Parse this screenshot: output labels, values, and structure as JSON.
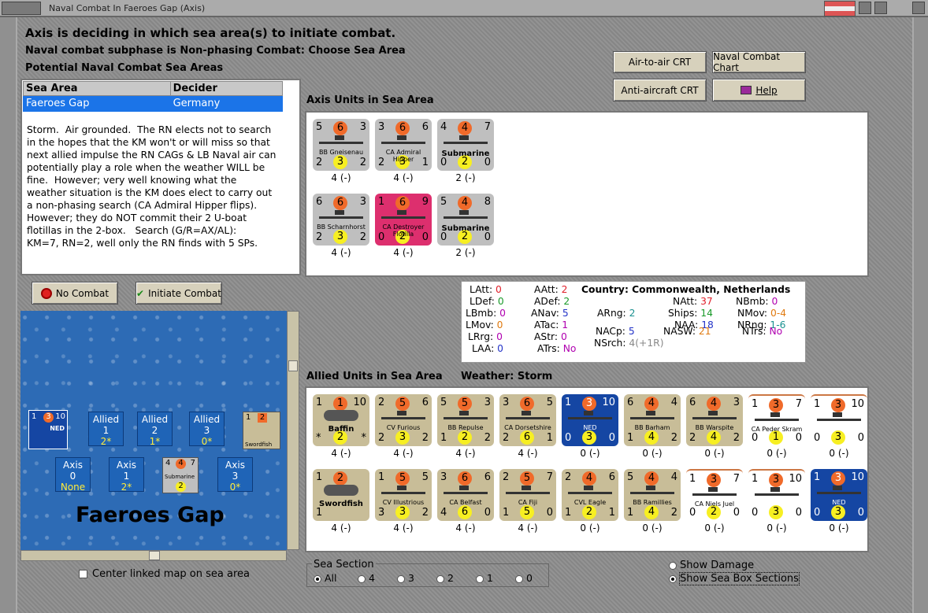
{
  "window": {
    "title": "Naval Combat In Faeroes Gap (Axis)"
  },
  "header": {
    "line1": "Axis is deciding in which sea area(s) to initiate combat.",
    "line2": "Naval combat subphase is Non-phasing Combat: Choose Sea Area",
    "line3": "Potential Naval Combat Sea Areas"
  },
  "buttons": {
    "air_to_air": "Air-to-air CRT",
    "naval_chart": "Naval Combat Chart",
    "anti_aircraft": "Anti-aircraft CRT",
    "help": "Help",
    "no_combat": "No Combat",
    "initiate_combat": "Initiate Combat"
  },
  "sea_table": {
    "col1": "Sea Area",
    "col2": "Decider",
    "row": {
      "area": "Faeroes Gap",
      "decider": "Germany"
    }
  },
  "description": "Storm.  Air grounded.  The RN elects not to search\nin the hopes that the KM won't or will miss so that\nnext allied impulse the RN CAGs & LB Naval air can\npotentially play a role when the weather WILL be\nfine.  However; very well knowing what the\nweather situation is the KM does elect to carry out\na non-phasing search (CA Admiral Hipper flips).\nHowever; they do NOT commit their 2 U-boat\nflotillas in the 2-box.   Search (G/R=AX/AL):\nKM=7, RN=2, well only the RN finds with 5 SPs.",
  "axis_label": "Axis Units in Sea Area",
  "axis_units": [
    {
      "tl": "5",
      "tc": "6",
      "tr": "3",
      "bl": "2",
      "bc": "3",
      "br": "2",
      "name": "BB Gneisenau",
      "count": "4 (-)",
      "style": "gray",
      "big": false
    },
    {
      "tl": "3",
      "tc": "6",
      "tr": "6",
      "bl": "2",
      "bc": "3",
      "br": "1",
      "name": "CA Admiral Hipper",
      "count": "4 (-)",
      "style": "gray",
      "big": false
    },
    {
      "tl": "4",
      "tc": "4",
      "tr": "7",
      "bl": "0",
      "bc": "2",
      "br": "0",
      "name": "Submarine",
      "count": "2 (-)",
      "style": "gray",
      "big": true
    },
    {
      "tl": "6",
      "tc": "6",
      "tr": "3",
      "bl": "2",
      "bc": "3",
      "br": "2",
      "name": "BB Scharnhorst",
      "count": "4 (-)",
      "style": "gray",
      "big": false
    },
    {
      "tl": "1",
      "tc": "6",
      "tr": "9",
      "bl": "0",
      "bc": "2",
      "br": "0",
      "name": "CA Destroyer Flotilla",
      "count": "4 (-)",
      "style": "pink",
      "big": false
    },
    {
      "tl": "5",
      "tc": "4",
      "tr": "8",
      "bl": "0",
      "bc": "2",
      "br": "0",
      "name": "Submarine",
      "count": "2 (-)",
      "style": "gray",
      "big": true
    }
  ],
  "stats": {
    "latt": "LAtt:",
    "latt_v": "0",
    "ldef": "LDef:",
    "ldef_v": "0",
    "lbmb": "LBmb:",
    "lbmb_v": "0",
    "lmov": "LMov:",
    "lmov_v": "0",
    "lrrg": "LRrg:",
    "lrrg_v": "0",
    "laa": "LAA:",
    "laa_v": "0",
    "aatt": "AAtt:",
    "aatt_v": "2",
    "adef": "ADef:",
    "adef_v": "2",
    "anav": "ANav:",
    "anav_v": "5",
    "atac": "ATac:",
    "atac_v": "1",
    "astr": "AStr:",
    "astr_v": "0",
    "atrs": "ATrs:",
    "atrs_v": "No",
    "country": "Country:",
    "country_v": "Commonwealth, Netherlands",
    "arng": "ARng:",
    "arng_v": "2",
    "nacp": "NACp:",
    "nacp_v": "5",
    "nsrch": "NSrch:",
    "nsrch_v": "4(+1R)",
    "natt": "NAtt:",
    "natt_v": "37",
    "ships": "Ships:",
    "ships_v": "14",
    "naa": "NAA:",
    "naa_v": "18",
    "nasw": "NASW:",
    "nasw_v": "21",
    "nbmb": "NBmb:",
    "nbmb_v": "0",
    "nmov": "NMov:",
    "nmov_v": "0-4",
    "nrng": "NRng:",
    "nrng_v": "1-6",
    "ntrs": "NTrs:",
    "ntrs_v": "No"
  },
  "allied_label": "Allied Units in Sea Area",
  "weather_label": "Weather:  Storm",
  "allied_units": [
    {
      "tl": "1",
      "tc": "1",
      "tr": "10",
      "bl": "*",
      "bc": "2",
      "br": "*",
      "name": "Baffin",
      "count": "4 (-)",
      "style": "tan",
      "big": true,
      "plane": true
    },
    {
      "tl": "2",
      "tc": "5",
      "tr": "6",
      "bl": "2",
      "bc": "3",
      "br": "2",
      "name": "CV Furious",
      "count": "4 (-)",
      "style": "tan",
      "big": false
    },
    {
      "tl": "5",
      "tc": "5",
      "tr": "3",
      "bl": "1",
      "bc": "2",
      "br": "2",
      "name": "BB Repulse",
      "count": "4 (-)",
      "style": "tan",
      "big": false
    },
    {
      "tl": "3",
      "tc": "6",
      "tr": "5",
      "bl": "2",
      "bc": "6",
      "br": "1",
      "name": "CA Dorsetshire",
      "count": "4 (-)",
      "style": "tan",
      "big": false
    },
    {
      "tl": "1",
      "tc": "3",
      "tr": "10",
      "bl": "0",
      "bc": "3",
      "br": "0",
      "name": "NED",
      "count": "0 (-)",
      "style": "blue",
      "big": false
    },
    {
      "tl": "6",
      "tc": "4",
      "tr": "4",
      "bl": "1",
      "bc": "4",
      "br": "2",
      "name": "BB Barham",
      "count": "0 (-)",
      "style": "tan",
      "big": false
    },
    {
      "tl": "6",
      "tc": "4",
      "tr": "3",
      "bl": "2",
      "bc": "4",
      "br": "2",
      "name": "BB Warspite",
      "count": "0 (-)",
      "style": "tan",
      "big": false
    },
    {
      "tl": "1",
      "tc": "3",
      "tr": "7",
      "bl": "0",
      "bc": "1",
      "br": "0",
      "name": "CA Peder Skram",
      "count": "0 (-)",
      "style": "white",
      "big": false
    },
    {
      "tl": "1",
      "tc": "3",
      "tr": "10",
      "bl": "0",
      "bc": "3",
      "br": "0",
      "name": "",
      "count": "0 (-)",
      "style": "white",
      "big": false
    },
    {
      "tl": "1",
      "tc": "2",
      "tr": "",
      "bl": "1",
      "bc": "",
      "br": "",
      "name": "Swordfish",
      "count": "4 (-)",
      "style": "tan",
      "big": true,
      "plane": true
    },
    {
      "tl": "1",
      "tc": "5",
      "tr": "5",
      "bl": "3",
      "bc": "3",
      "br": "2",
      "name": "CV Illustrious",
      "count": "4 (-)",
      "style": "tan",
      "big": false
    },
    {
      "tl": "3",
      "tc": "6",
      "tr": "6",
      "bl": "4",
      "bc": "6",
      "br": "0",
      "name": "CA Belfast",
      "count": "4 (-)",
      "style": "tan",
      "big": false
    },
    {
      "tl": "2",
      "tc": "5",
      "tr": "7",
      "bl": "1",
      "bc": "5",
      "br": "0",
      "name": "CA Fiji",
      "count": "4 (-)",
      "style": "tan",
      "big": false
    },
    {
      "tl": "2",
      "tc": "4",
      "tr": "6",
      "bl": "1",
      "bc": "2",
      "br": "1",
      "name": "CVL Eagle",
      "count": "0 (-)",
      "style": "tan",
      "big": false
    },
    {
      "tl": "5",
      "tc": "4",
      "tr": "4",
      "bl": "1",
      "bc": "4",
      "br": "2",
      "name": "BB Ramillies",
      "count": "0 (-)",
      "style": "tan",
      "big": false
    },
    {
      "tl": "1",
      "tc": "3",
      "tr": "7",
      "bl": "0",
      "bc": "2",
      "br": "0",
      "name": "CA Niels Juel",
      "count": "0 (-)",
      "style": "white",
      "big": false
    },
    {
      "tl": "1",
      "tc": "3",
      "tr": "10",
      "bl": "0",
      "bc": "3",
      "br": "0",
      "name": "",
      "count": "0 (-)",
      "style": "white",
      "big": false
    },
    {
      "tl": "1",
      "tc": "3",
      "tr": "10",
      "bl": "0",
      "bc": "3",
      "br": "0",
      "name": "NED",
      "count": "0 (-)",
      "style": "blue",
      "big": false
    }
  ],
  "map": {
    "sea_name": "Faeroes Gap",
    "allied_boxes": [
      {
        "label": "Allied",
        "num": "1",
        "val": "2*"
      },
      {
        "label": "Allied",
        "num": "2",
        "val": "1*"
      },
      {
        "label": "Allied",
        "num": "3",
        "val": "0*"
      }
    ],
    "axis_boxes": [
      {
        "label": "Axis",
        "num": "0",
        "val": "None"
      },
      {
        "label": "Axis",
        "num": "1",
        "val": "2*"
      },
      {
        "label": "Axis",
        "num": "3",
        "val": "0*"
      }
    ],
    "sub_counter": {
      "tl": "4",
      "tc": "4",
      "tr": "7",
      "bc": "2",
      "name": "Submarine",
      "stack": "2"
    },
    "ned_counter": {
      "tl": "1",
      "tc": "3",
      "tr": "10",
      "stack": "10",
      "name": "NED"
    },
    "sword_counter": {
      "tl": "1",
      "tc": "2",
      "name": "Swordfish",
      "stack": "8"
    },
    "center_label": "Center linked map on sea area"
  },
  "sea_section": {
    "title": "Sea Section",
    "options": [
      "All",
      "4",
      "3",
      "2",
      "1",
      "0"
    ],
    "selected": "All"
  },
  "display_opts": {
    "show_damage": "Show Damage",
    "show_sections": "Show Sea Box Sections"
  }
}
